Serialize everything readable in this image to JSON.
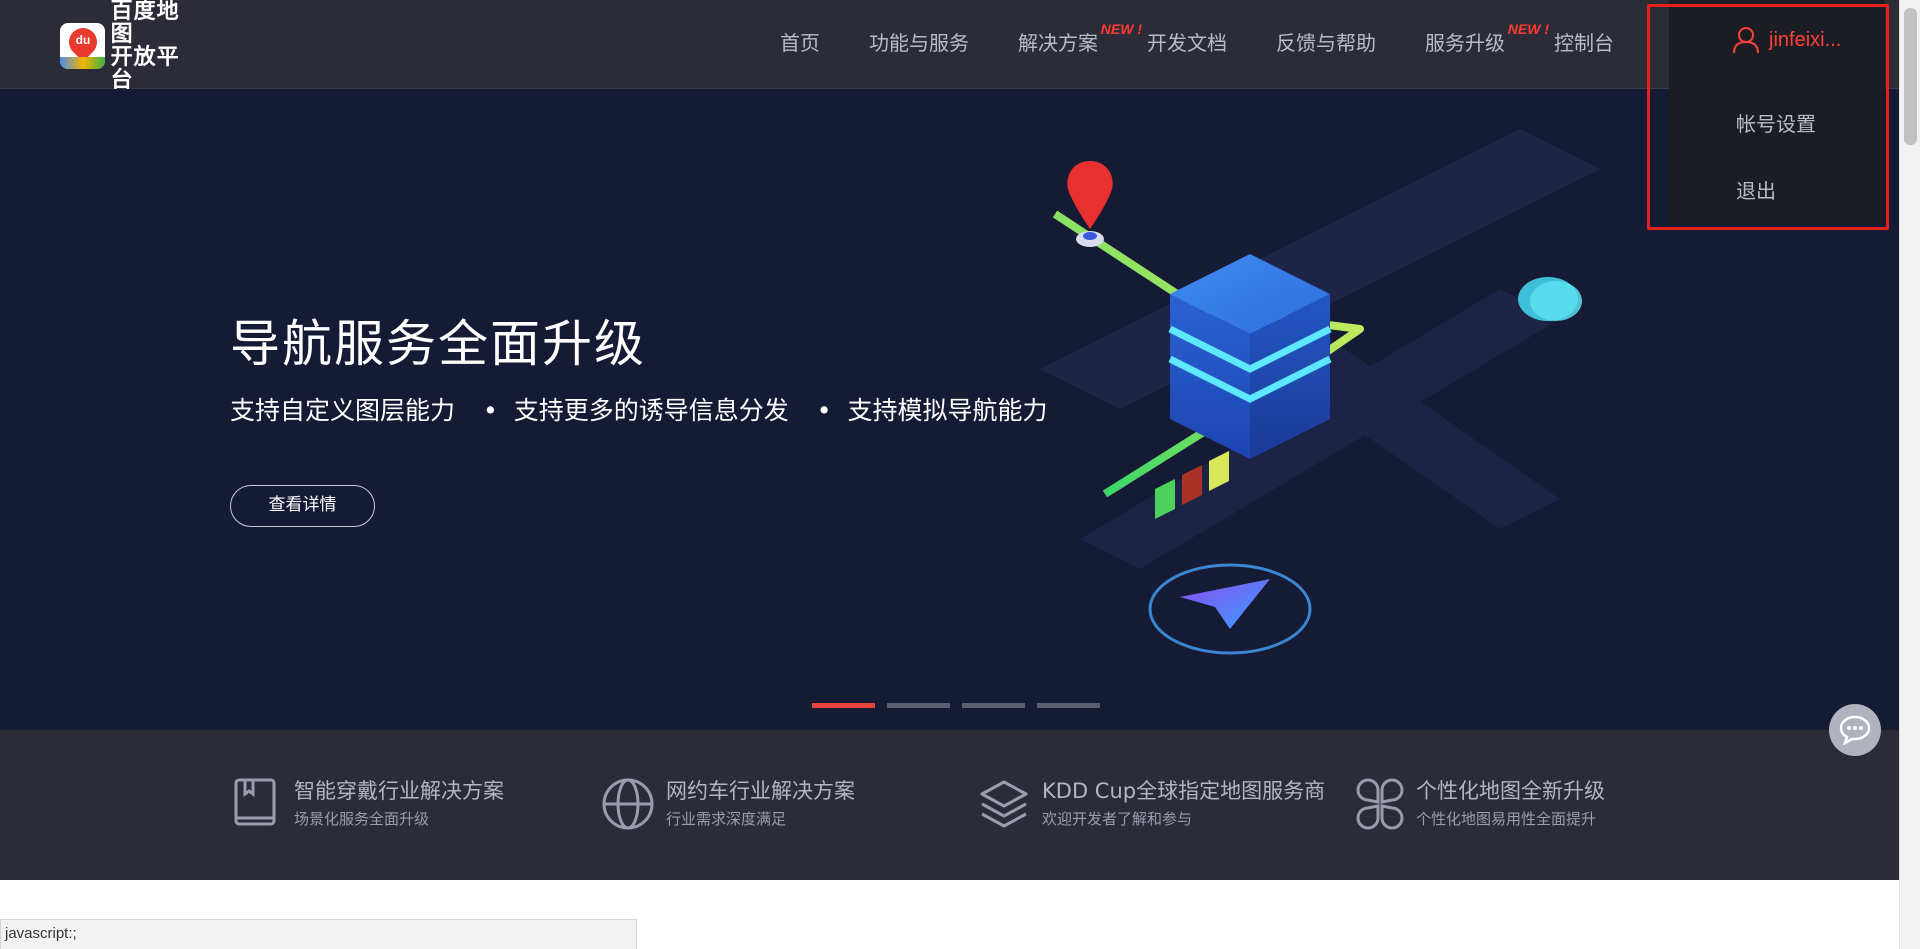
{
  "header": {
    "logo_line1": "百度地图",
    "logo_line2": "开放平台",
    "logo_mark": "du",
    "nav": [
      {
        "label": "首页",
        "new": ""
      },
      {
        "label": "功能与服务",
        "new": ""
      },
      {
        "label": "解决方案",
        "new": "NEW !"
      },
      {
        "label": "开发文档",
        "new": ""
      },
      {
        "label": "反馈与帮助",
        "new": ""
      },
      {
        "label": "服务升级",
        "new": "NEW !"
      },
      {
        "label": "控制台",
        "new": ""
      }
    ]
  },
  "user_menu": {
    "username": "jinfeixi...",
    "items": [
      "帐号设置",
      "退出"
    ]
  },
  "banner": {
    "title": "导航服务全面升级",
    "subs": [
      "支持自定义图层能力",
      "支持更多的诱导信息分发",
      "支持模拟导航能力"
    ],
    "bullet": "•",
    "button": "查看详情",
    "slides_total": 4,
    "slide_active": 1
  },
  "features": [
    {
      "icon": "book-icon",
      "title": "智能穿戴行业解决方案",
      "sub": "场景化服务全面升级"
    },
    {
      "icon": "globe-icon",
      "title": "网约车行业解决方案",
      "sub": "行业需求深度满足"
    },
    {
      "icon": "layers-icon",
      "title": "KDD Cup全球指定地图服务商",
      "sub": "欢迎开发者了解和参与"
    },
    {
      "icon": "clover-icon",
      "title": "个性化地图全新升级",
      "sub": "个性化地图易用性全面提升"
    }
  ],
  "status_bar": "javascript:;",
  "colors": {
    "header_bg": "#2b2c37",
    "banner_bg": "#151a35",
    "accent_red": "#e8453c",
    "username_red": "#ff4136"
  }
}
